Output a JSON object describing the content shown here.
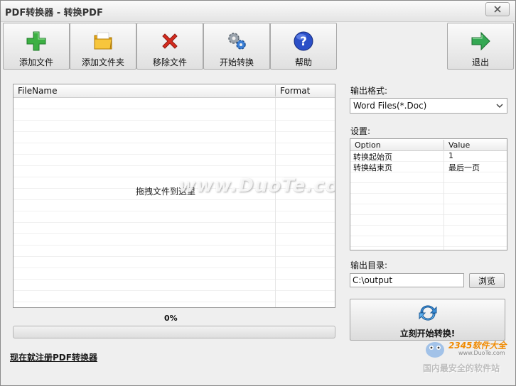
{
  "window": {
    "title": "PDF转换器 - 转换PDF"
  },
  "toolbar": {
    "add_file": "添加文件",
    "add_folder": "添加文件夹",
    "remove_file": "移除文件",
    "start_convert": "开始转换",
    "help": "帮助",
    "exit": "退出"
  },
  "file_list": {
    "col_filename": "FileName",
    "col_format": "Format",
    "drop_hint": "拖拽文件到这里",
    "watermark": "www.DuoTe.com"
  },
  "progress": {
    "percent_label": "0%",
    "value": 0
  },
  "register_link": "现在就注册PDF转换器",
  "output_format": {
    "label": "输出格式:",
    "selected": "Word Files(*.Doc)"
  },
  "settings": {
    "label": "设置:",
    "col_option": "Option",
    "col_value": "Value",
    "rows": [
      {
        "option": "转换起始页",
        "value": "1"
      },
      {
        "option": "转换结束页",
        "value": "最后一页"
      }
    ]
  },
  "output_dir": {
    "label": "输出目录:",
    "value": "C:\\output",
    "browse": "浏览"
  },
  "start_button": {
    "label": "立刻开始转换!"
  },
  "corner_logo": {
    "brand": "2345软件大全",
    "url": "www.DuoTe.com",
    "slogan": "国内最安全的软件站"
  },
  "colors": {
    "add_icon": "#3cb043",
    "folder_icon": "#f2b51c",
    "remove_icon": "#d62b1f",
    "help_icon": "#2b4fc7",
    "exit_icon": "#34a853",
    "progress_fill": "#37b24d"
  }
}
